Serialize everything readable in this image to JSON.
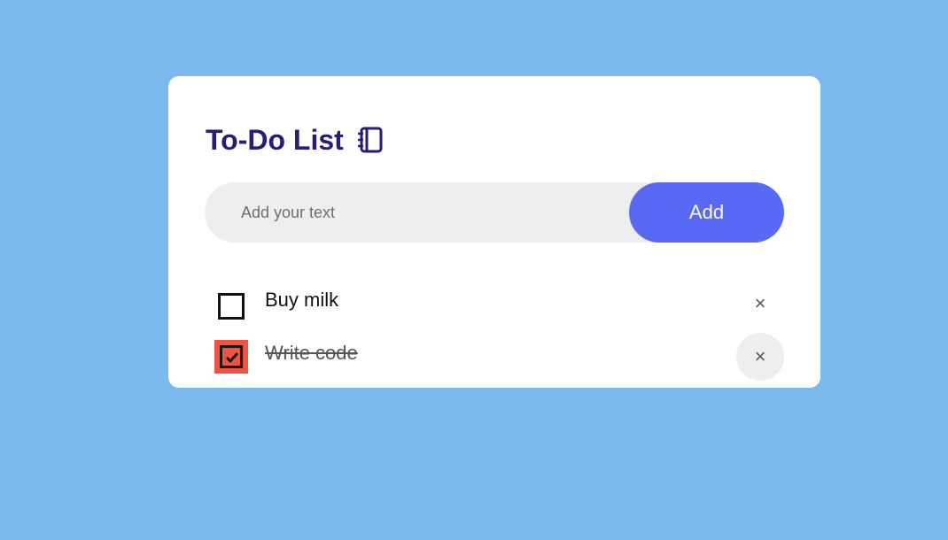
{
  "header": {
    "title": "To-Do List",
    "title_icon": "notebook-icon"
  },
  "input": {
    "placeholder": "Add your text",
    "value": "",
    "add_label": "Add"
  },
  "todos": [
    {
      "text": "Buy milk",
      "checked": false,
      "delete_icon": "close-icon",
      "delete_label": "×"
    },
    {
      "text": "Write code",
      "checked": true,
      "delete_icon": "close-icon",
      "delete_label": "×"
    }
  ],
  "colors": {
    "background": "#7cb9ef",
    "card": "#ffffff",
    "title": "#2b1b7a",
    "accent": "#5869f5",
    "checked": "#f0533f",
    "input_bg": "#edeef0"
  }
}
